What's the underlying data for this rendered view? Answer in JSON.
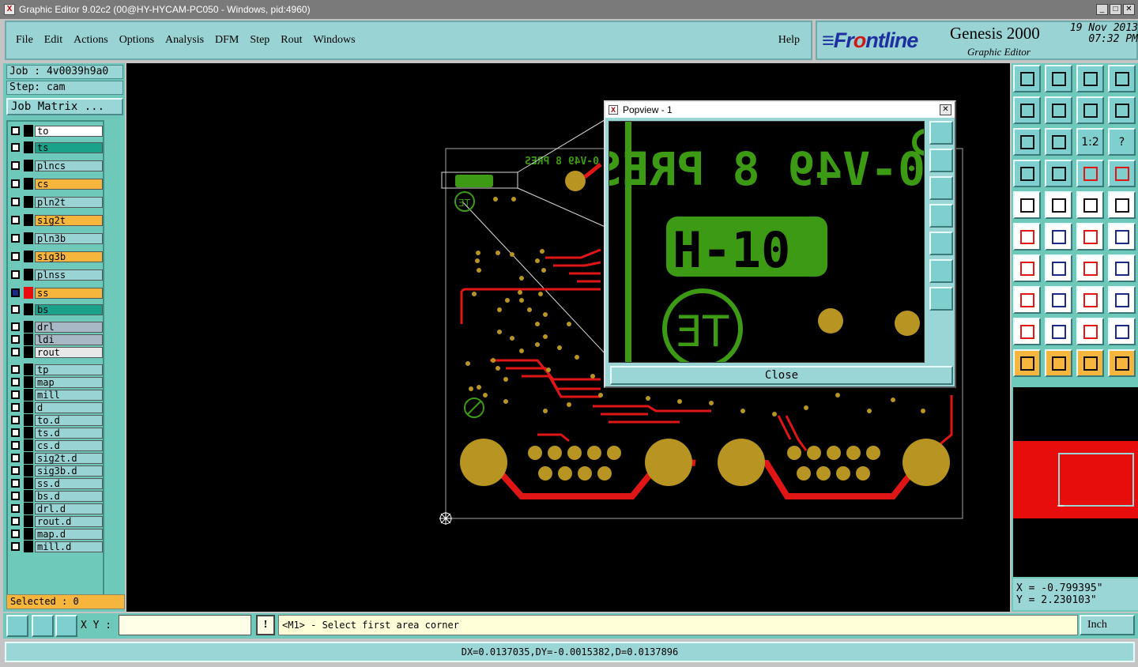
{
  "window": {
    "title": "Graphic Editor 9.02c2 (00@HY-HYCAM-PC050 - Windows, pid:4960)"
  },
  "menu": {
    "items": [
      "File",
      "Edit",
      "Actions",
      "Options",
      "Analysis",
      "DFM",
      "Step",
      "Rout",
      "Windows"
    ],
    "help": "Help"
  },
  "brand": {
    "logo_a": "≡Fr",
    "logo_b": "o",
    "logo_c": "ntline",
    "product": "Genesis 2000",
    "subtitle": "Graphic Editor",
    "date": "19 Nov 2013",
    "time": "07:32 PM"
  },
  "job": {
    "job_label": "Job : 4v0039h9a0",
    "step_label": "Step: cam",
    "matrix_button": "Job Matrix ..."
  },
  "layers": [
    {
      "name": "to",
      "color": "#ffffff"
    },
    {
      "name": "ts",
      "color": "#1aa38a"
    },
    {
      "name": "plncs",
      "color": "#99d3d3"
    },
    {
      "name": "cs",
      "color": "#f6b53c"
    },
    {
      "name": "pln2t",
      "color": "#99d3d3"
    },
    {
      "name": "sig2t",
      "color": "#f6b53c"
    },
    {
      "name": "pln3b",
      "color": "#99d3d3"
    },
    {
      "name": "sig3b",
      "color": "#f6b53c"
    },
    {
      "name": "plnss",
      "color": "#99d3d3"
    },
    {
      "name": "ss",
      "color": "#f6b53c",
      "active": true
    },
    {
      "name": "bs",
      "color": "#1aa38a"
    },
    {
      "name": "drl",
      "color": "#a8b8c4"
    },
    {
      "name": "ldi",
      "color": "#a8b8c4"
    },
    {
      "name": "rout",
      "color": "#e8e8e8"
    },
    {
      "name": "tp",
      "color": "#99d3d3"
    },
    {
      "name": "map",
      "color": "#99d3d3"
    },
    {
      "name": "mill",
      "color": "#99d3d3"
    },
    {
      "name": "d",
      "color": "#99d3d3"
    },
    {
      "name": "to.d",
      "color": "#99d3d3"
    },
    {
      "name": "ts.d",
      "color": "#99d3d3"
    },
    {
      "name": "cs.d",
      "color": "#99d3d3"
    },
    {
      "name": "sig2t.d",
      "color": "#99d3d3"
    },
    {
      "name": "sig3b.d",
      "color": "#99d3d3"
    },
    {
      "name": "ss.d",
      "color": "#99d3d3"
    },
    {
      "name": "bs.d",
      "color": "#99d3d3"
    },
    {
      "name": "drl.d",
      "color": "#99d3d3"
    },
    {
      "name": "rout.d",
      "color": "#99d3d3"
    },
    {
      "name": "map.d",
      "color": "#99d3d3"
    },
    {
      "name": "mill.d",
      "color": "#99d3d3"
    }
  ],
  "selected": "Selected : 0",
  "popview": {
    "title": "Popview - 1",
    "close": "Close",
    "silk_line1": "0-V49 8 PRES",
    "silk_code": "H-10",
    "logo": "ƎT"
  },
  "board": {
    "silk_top": "0-V49 8 PRES",
    "logo": "ƎT"
  },
  "coords": {
    "x": "X = -0.799395\"",
    "y": "Y = 2.230103\""
  },
  "command": {
    "xy_label": "X Y :",
    "excl": "!",
    "prompt": "<M1> - Select first area corner",
    "units": "Inch"
  },
  "status": "DX=0.0137035,DY=-0.0015382,D=0.0137896",
  "icons": {
    "tool_grid": [
      "export-icon",
      "save-icon",
      "home-icon",
      "frame-icon",
      "undo-icon",
      "redo-icon",
      "swap-icon",
      "zigzag-icon",
      "fit-icon",
      "center-icon",
      "ratio-icon",
      "help-icon",
      "measure-icon",
      "grid-icon",
      "layer-red-icon",
      "layer-red2-icon",
      "select-icon",
      "edit-icon",
      "ruler-icon",
      "dot-icon",
      "connect-icon",
      "cross-icon",
      "link-icon",
      "link2-icon",
      "angle-icon",
      "line-icon",
      "arc-icon",
      "flag-icon",
      "pad-icon",
      "route-icon",
      "dimension-icon",
      "group-icon",
      "triangle-icon",
      "triangle2-icon",
      "triangle3-icon",
      "triangle4-icon",
      "pointer-icon",
      "pointer2-icon",
      "pointer3-icon",
      "pointer4-icon"
    ],
    "tool_labels": {
      "ratio-icon": "1:2",
      "help-icon": "?"
    }
  },
  "colors": {
    "panel": "#6fc9ba",
    "silk": "#3c9a14",
    "copper": "#b89422",
    "trace": "#e01616"
  }
}
